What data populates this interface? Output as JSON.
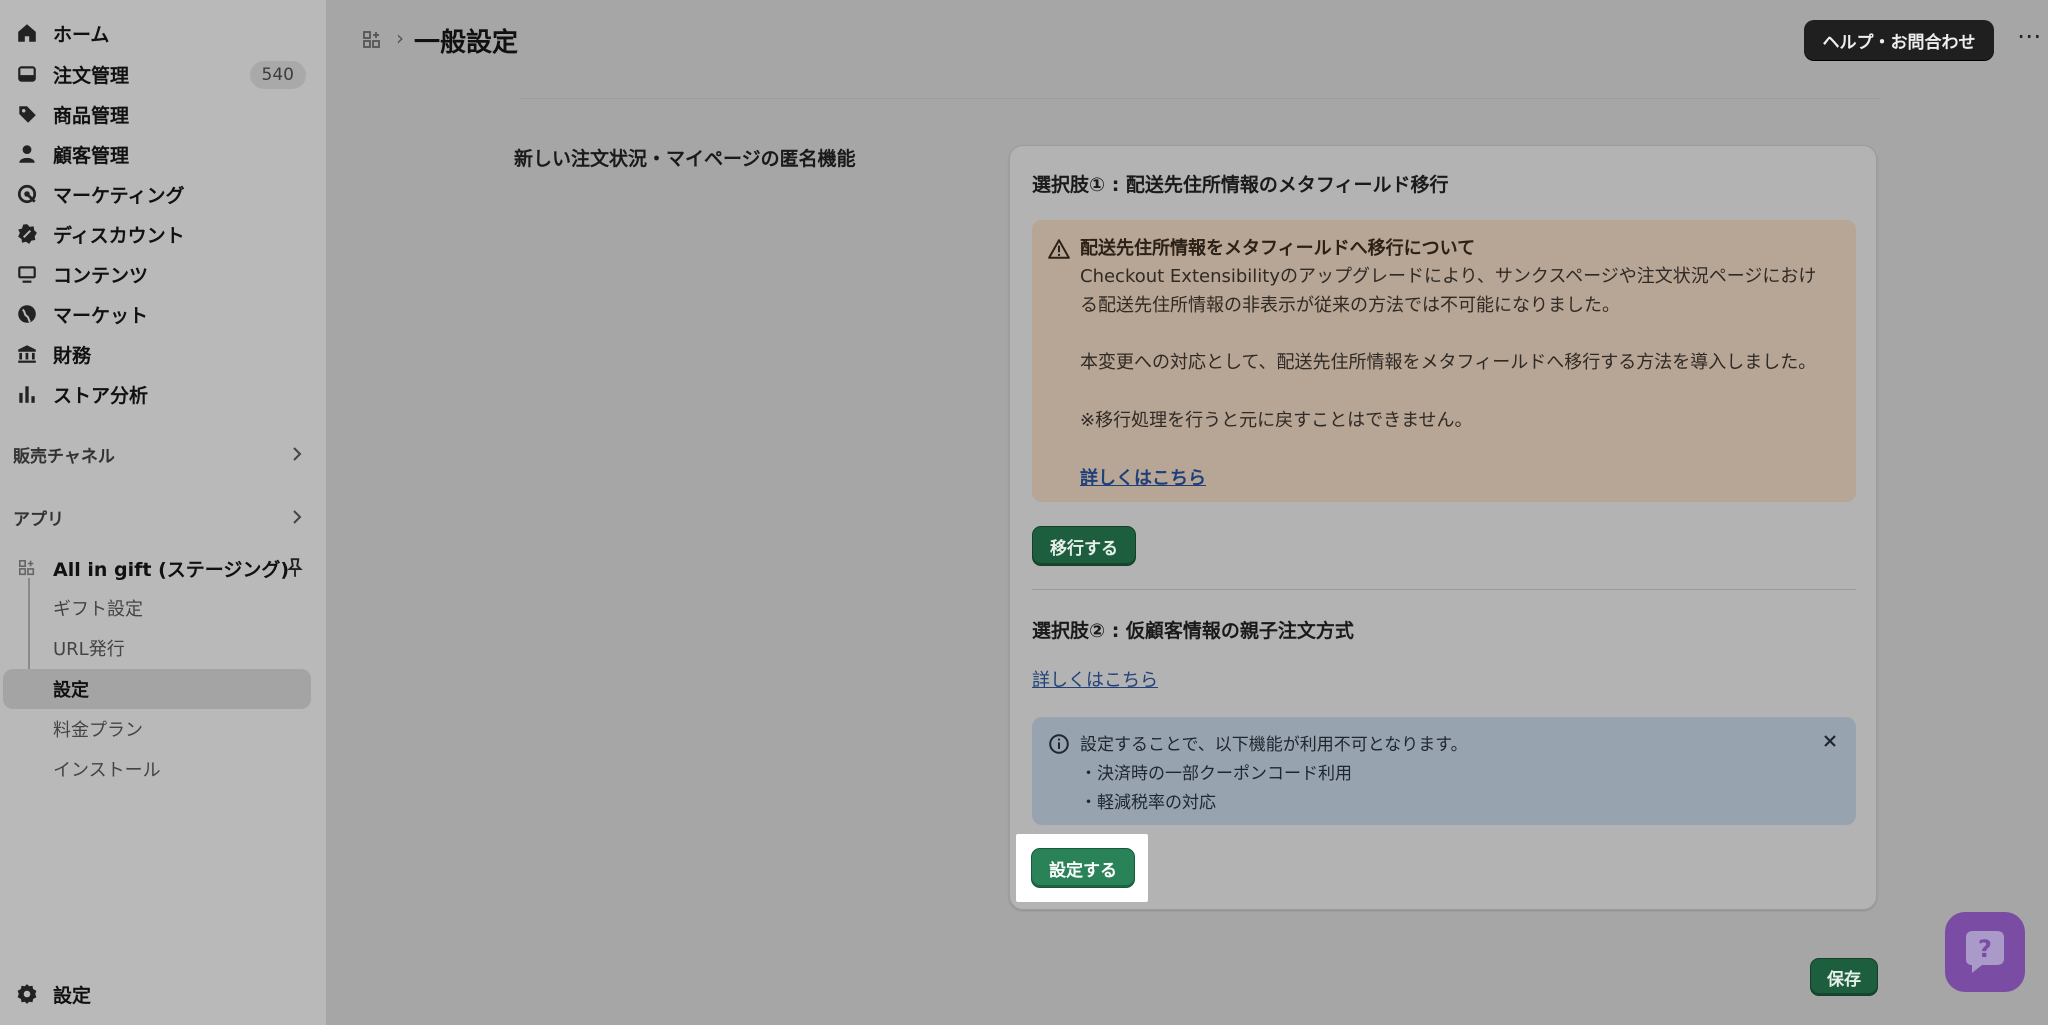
{
  "sidebar": {
    "nav": [
      {
        "label": "ホーム",
        "icon": "home-icon"
      },
      {
        "label": "注文管理",
        "icon": "inbox-icon",
        "badge": "540"
      },
      {
        "label": "商品管理",
        "icon": "tag-icon"
      },
      {
        "label": "顧客管理",
        "icon": "person-icon"
      },
      {
        "label": "マーケティング",
        "icon": "target-icon"
      },
      {
        "label": "ディスカウント",
        "icon": "discount-icon"
      },
      {
        "label": "コンテンツ",
        "icon": "content-icon"
      },
      {
        "label": "マーケット",
        "icon": "globe-icon"
      },
      {
        "label": "財務",
        "icon": "bank-icon"
      },
      {
        "label": "ストア分析",
        "icon": "bar-chart-icon"
      }
    ],
    "sales_channels": "販売チャネル",
    "apps": "アプリ",
    "app_name": "All in gift (ステージング)",
    "sub_items": [
      "ギフト設定",
      "URL発行",
      "設定",
      "料金プラン",
      "インストール"
    ],
    "settings": "設定"
  },
  "header": {
    "title": "一般設定",
    "help_button": "ヘルプ・お問合わせ",
    "more": "⋯"
  },
  "section": {
    "heading": "新しい注文状況・マイページの匿名機能"
  },
  "option1": {
    "title": "選択肢① : 配送先住所情報のメタフィールド移行",
    "banner_title": "配送先住所情報をメタフィールドへ移行について",
    "line1": "Checkout Extensibilityのアップグレードにより、サンクスページや注文状況ページにおけ",
    "line2": "る配送先住所情報の非表示が従来の方法では不可能になりました。",
    "line3": "本変更への対応として、配送先住所情報をメタフィールドへ移行する方法を導入しました。",
    "line4": "※移行処理を行うと元に戻すことはできません。",
    "link": "詳しくはこちら",
    "button": "移行する"
  },
  "option2": {
    "title": "選択肢② : 仮顧客情報の親子注文方式",
    "link": "詳しくはこちら",
    "info_line1": "設定することで、以下機能が利用不可となります。",
    "info_line2": "・決済時の一部クーポンコード利用",
    "info_line3": "・軽減税率の対応",
    "button": "設定する"
  },
  "footer": {
    "save": "保存"
  }
}
